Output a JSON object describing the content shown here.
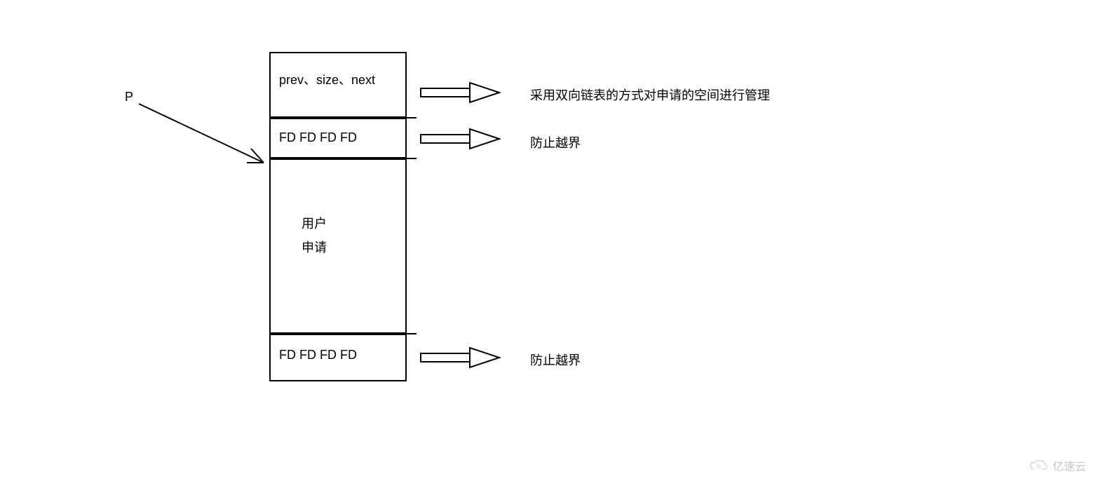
{
  "pointer_label": "P",
  "blocks": {
    "header": "prev、size、next",
    "guard1": "FD FD FD FD",
    "user_line1": "用户",
    "user_line2": "申请",
    "guard2": "FD FD FD FD"
  },
  "annotations": {
    "header_note": "采用双向链表的方式对申请的空间进行管理",
    "guard1_note": "防止越界",
    "guard2_note": "防止越界"
  },
  "watermark": "亿速云"
}
